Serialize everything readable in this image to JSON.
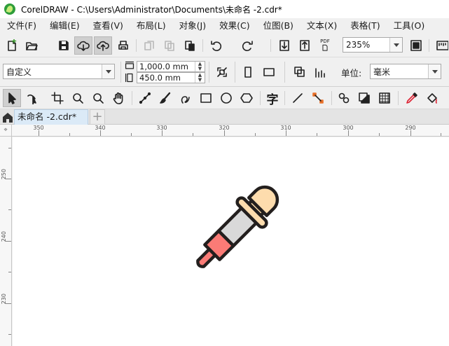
{
  "window": {
    "title": "CorelDRAW - C:\\Users\\Administrator\\Documents\\未命名 -2.cdr*"
  },
  "menu": [
    "文件(F)",
    "编辑(E)",
    "查看(V)",
    "布局(L)",
    "对象(J)",
    "效果(C)",
    "位图(B)",
    "文本(X)",
    "表格(T)",
    "工具(O)"
  ],
  "standard_toolbar": {
    "zoom": "235%",
    "pdf_label": "PDF"
  },
  "property_bar": {
    "page_size": "自定义",
    "width": "1,000.0 mm",
    "height": "450.0 mm",
    "units_label": "单位:",
    "units": "毫米"
  },
  "toolbox": {
    "text_tool_glyph": "字"
  },
  "tabs": {
    "doc_tab": "未命名 -2.cdr*",
    "new_tab": "+"
  },
  "ruler": {
    "corner": "⌖",
    "h_ticks": [
      "350",
      "340",
      "330",
      "320",
      "310",
      "300",
      "290"
    ],
    "v_ticks": [
      "250",
      "240",
      "230"
    ]
  },
  "artwork": {
    "name": "dropper",
    "bulb_color": "#fddcad",
    "glass_color": "#d9d9d9",
    "liquid_color": "#fb7b76",
    "outline_color": "#231f1e"
  }
}
